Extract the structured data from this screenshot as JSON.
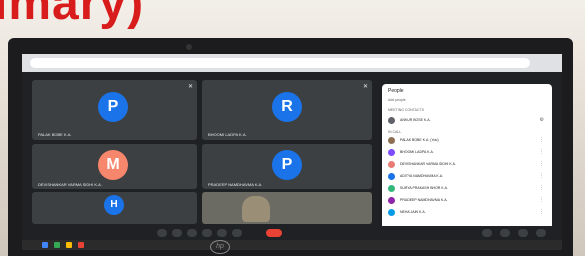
{
  "photo": {
    "title_fragment": "imary)"
  },
  "meet": {
    "tiles": [
      {
        "letter": "P",
        "name": "PALAK BOBE K.A.",
        "color": "#1a73e8"
      },
      {
        "letter": "R",
        "name": "BHOOMI LADPA K.A.",
        "color": "#1a73e8"
      },
      {
        "letter": "M",
        "name": "DEVISHANKAR VARMA SIDHI K.A.",
        "color": "#f6866c"
      },
      {
        "letter": "P",
        "name": "PRADEEP NAMDHAVMA K.A.",
        "color": "#1a73e8"
      },
      {
        "letter": "H",
        "name": "",
        "color": "#1a73e8"
      }
    ],
    "people_panel": {
      "title": "People",
      "add_people": "Add people",
      "meeting_contacts_label": "MEETING CONTACTS",
      "host": "ANKUR BOSE K.A.",
      "in_call_label": "IN CALL",
      "participants": [
        "PALAK BOBE K.A. (You)",
        "BHOOMI LADPA K.A.",
        "DEVISHANKAR VARMA SIDHI K.A.",
        "ADITYA NAMDHAVMA K.A.",
        "SURYA PRAKASH BHOR K.A.",
        "PRADEEP NAMDHAVMA K.A.",
        "NEHA JAIN K.A."
      ]
    }
  },
  "laptop": {
    "brand": "hp"
  }
}
